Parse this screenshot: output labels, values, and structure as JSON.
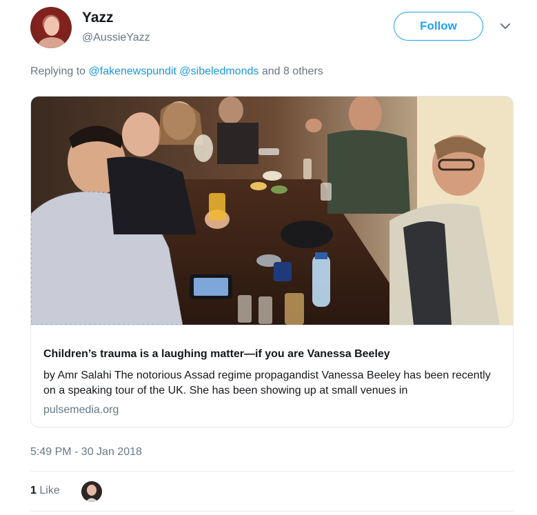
{
  "tweet": {
    "display_name": "Yazz",
    "handle": "@AussieYazz",
    "follow_label": "Follow",
    "reply": {
      "prefix": "Replying to",
      "mentions": [
        "@fakenewspundit",
        "@sibeledmonds"
      ],
      "others": "and 8 others"
    },
    "card": {
      "title": "Children’s trauma is a laughing matter—if you are Vanessa Beeley",
      "description": "by Amr Salahi The notorious Assad regime propagandist Vanessa Beeley has been recently on a speaking tour of the UK. She has been showing up at small venues  in",
      "domain": "pulsemedia.org"
    },
    "timestamp": "5:49 PM - 30 Jan 2018",
    "likes": {
      "count": "1",
      "label": "Like"
    }
  },
  "colors": {
    "accent": "#1da1f2",
    "link": "#1b95e0",
    "muted": "#657786",
    "text": "#14171a",
    "border": "#e1e8ed"
  },
  "icons": {
    "menu": "chevron-down-icon"
  }
}
